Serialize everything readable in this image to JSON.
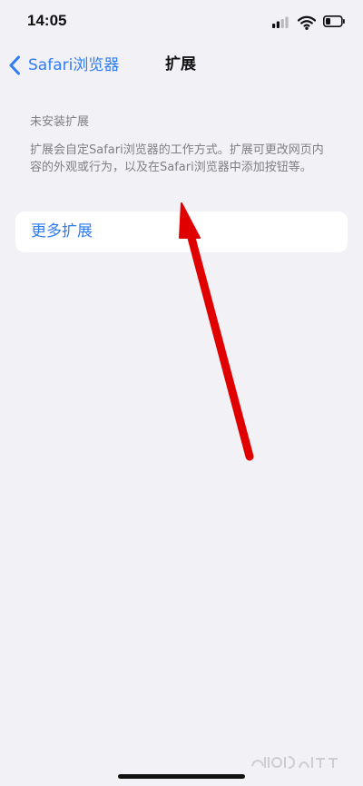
{
  "status_bar": {
    "time": "14:05",
    "icons": [
      "cellular-signal-icon",
      "wifi-icon",
      "battery-icon"
    ]
  },
  "nav": {
    "back_label": "Safari浏览器",
    "title": "扩展"
  },
  "content": {
    "section_header": "未安装扩展",
    "section_description": "扩展会自定Safari浏览器的工作方式。扩展可更改网页内容的外观或行为，以及在Safari浏览器中添加按钮等。"
  },
  "actions": {
    "more_extensions_label": "更多扩展"
  },
  "colors": {
    "background": "#f1f1f6",
    "link_blue": "#2f7cf6",
    "secondary_text": "#7f7f84",
    "card_background": "#ffffff",
    "annotation_red": "#e10000"
  }
}
